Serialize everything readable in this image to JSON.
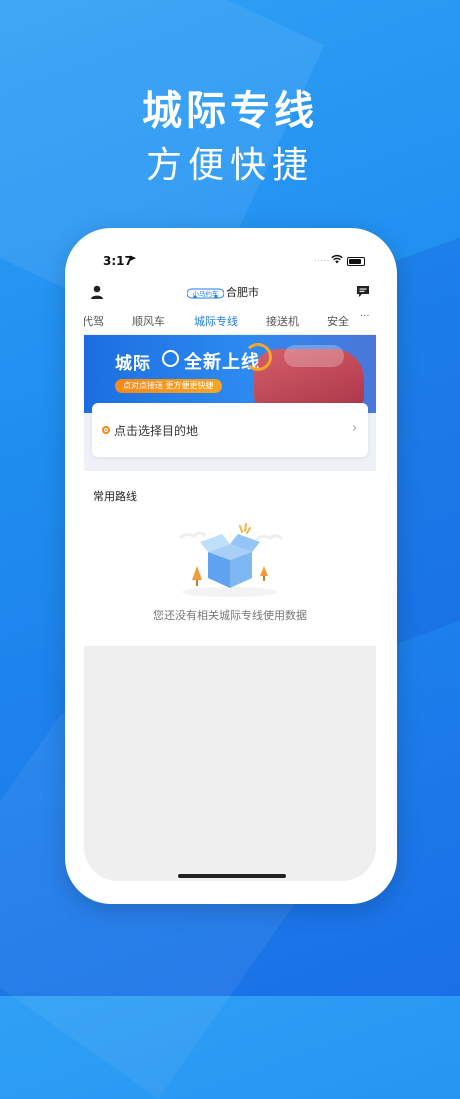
{
  "promo": {
    "headline": "城际专线",
    "subheadline": "方便快捷"
  },
  "status_bar": {
    "time": "3:17",
    "signal": "·····"
  },
  "header": {
    "logo_text": "小马约车",
    "city": "合肥市"
  },
  "tabs": [
    {
      "label": "代驾",
      "active": false
    },
    {
      "label": "顺风车",
      "active": false
    },
    {
      "label": "城际专线",
      "active": true
    },
    {
      "label": "接送机",
      "active": false
    },
    {
      "label": "安全",
      "active": false
    }
  ],
  "tabs_more": "···",
  "banner": {
    "title_part1": "城际",
    "title_part2": "全新上线",
    "tagline": "点对点接送  更方便更快捷"
  },
  "destination": {
    "placeholder": "点击选择目的地",
    "chevron": "›"
  },
  "common_routes": {
    "title": "常用路线",
    "empty_text": "您还没有相关城际专线使用数据"
  },
  "colors": {
    "accent": "#1e7be8",
    "orange": "#f08a1c",
    "background_blue": "#1f8df0"
  }
}
